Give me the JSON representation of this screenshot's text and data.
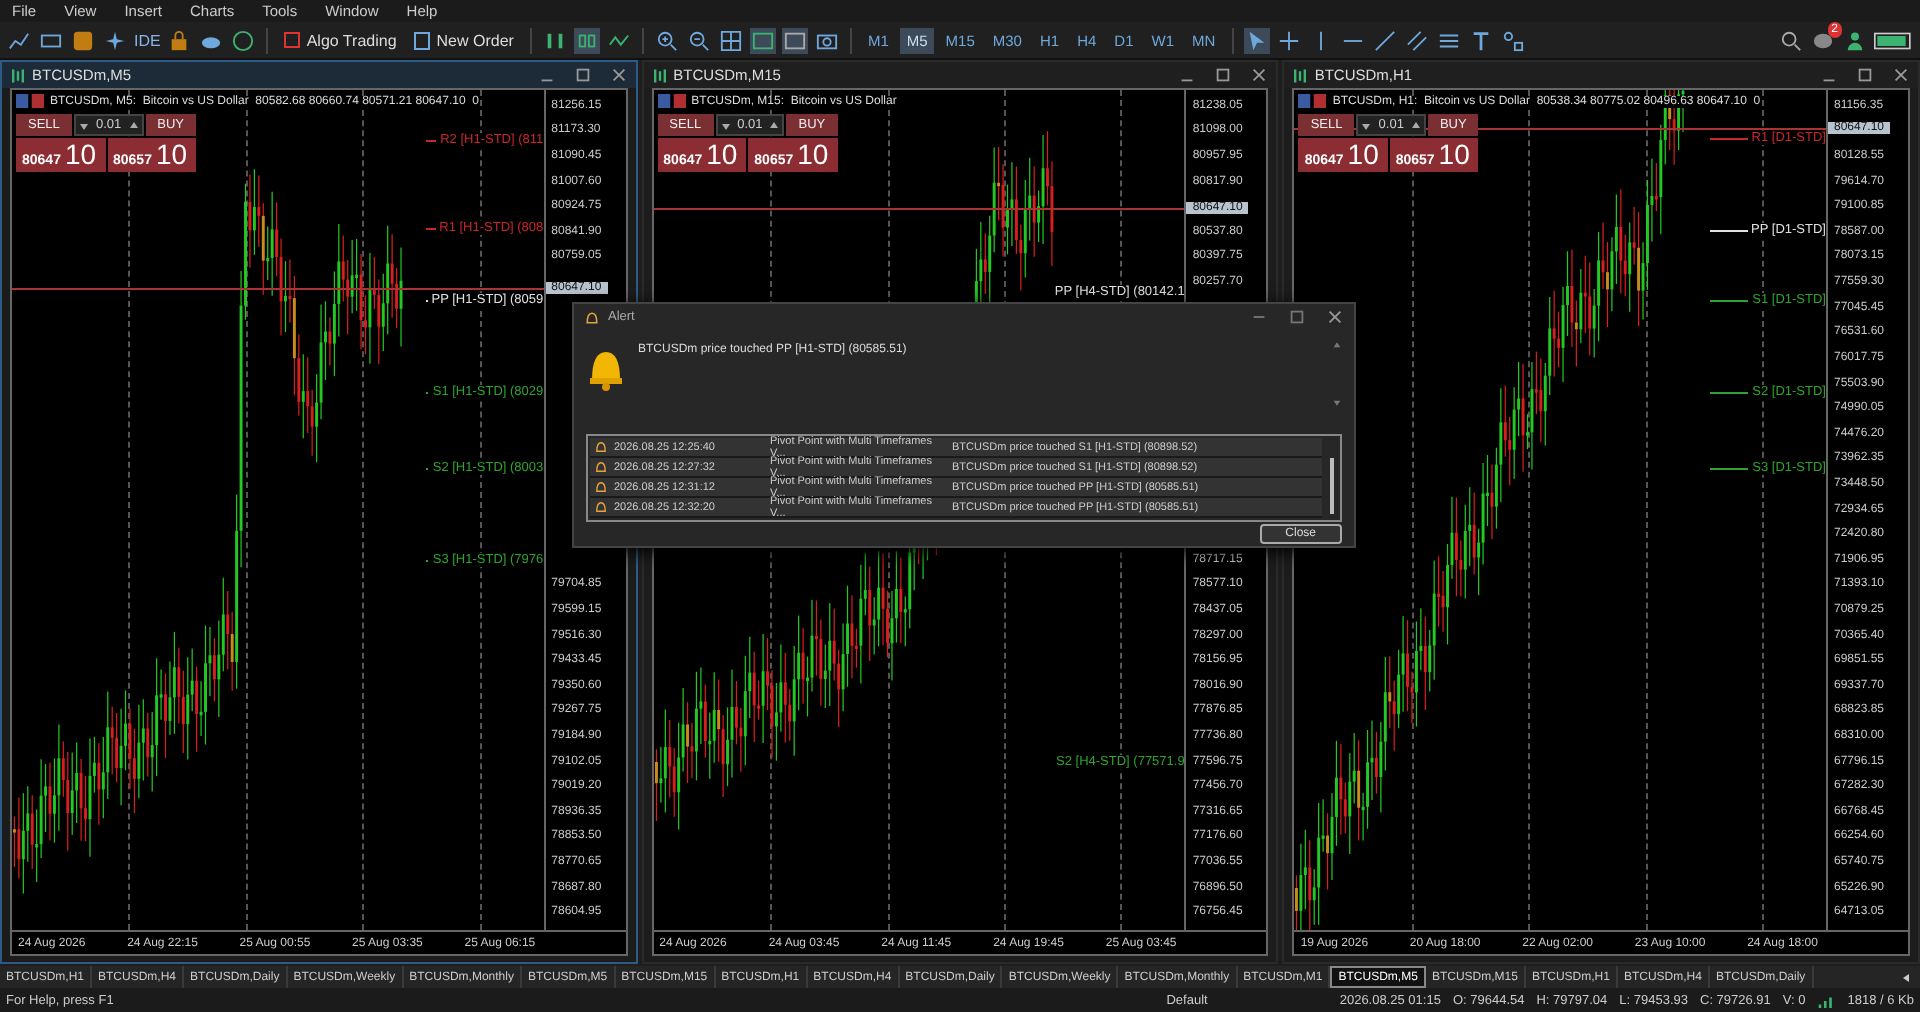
{
  "menu": [
    "File",
    "View",
    "Insert",
    "Charts",
    "Tools",
    "Window",
    "Help"
  ],
  "toolbar": {
    "ide": "IDE",
    "algo_trading": "Algo Trading",
    "new_order": "New Order",
    "notification_badge": "2",
    "timeframes": [
      {
        "label": "M1",
        "selected": false
      },
      {
        "label": "M5",
        "selected": true
      },
      {
        "label": "M15",
        "selected": false
      },
      {
        "label": "M30",
        "selected": false
      },
      {
        "label": "H1",
        "selected": false
      },
      {
        "label": "H4",
        "selected": false
      },
      {
        "label": "D1",
        "selected": false
      },
      {
        "label": "W1",
        "selected": false
      },
      {
        "label": "MN",
        "selected": false
      }
    ]
  },
  "charts": [
    {
      "title": "BTCUSDm,M5",
      "active": true,
      "info": "BTCUSDm, M5:  Bitcoin vs US Dollar  80582.68 80660.74 80571.21 80647.10  0",
      "trade": {
        "sell": "SELL",
        "buy": "BUY",
        "volume": "0.01",
        "bid_small": "80647",
        "bid_big": "10",
        "ask_small": "80657",
        "ask_big": "10"
      },
      "current_price": "80647.10",
      "price_groups": [
        [
          "81256.15",
          "81173.30",
          "81090.45",
          "81007.60",
          "80924.75",
          "80841.90",
          "80759.05"
        ],
        [
          "79704.85",
          "79599.15",
          "79516.30",
          "79433.45",
          "79350.60",
          "79267.75",
          "79184.90",
          "79102.05",
          "79019.20",
          "78936.35",
          "78853.50",
          "78770.65",
          "78687.80",
          "78604.95"
        ]
      ],
      "pivots": [
        {
          "label": "R2 [H1-STD] (811",
          "kind": "resistance"
        },
        {
          "label": "R1 [H1-STD] (808",
          "kind": "resistance"
        },
        {
          "label": "PP [H1-STD] (8059",
          "kind": "pivot"
        },
        {
          "label": "S1 [H1-STD] (8029",
          "kind": "support"
        },
        {
          "label": "S2 [H1-STD] (8003",
          "kind": "support"
        },
        {
          "label": "S3 [H1-STD] (7976",
          "kind": "support"
        }
      ],
      "times": [
        "24 Aug 2026",
        "24 Aug 22:15",
        "25 Aug 00:55",
        "25 Aug 03:35",
        "25 Aug 06:15"
      ]
    },
    {
      "title": "BTCUSDm,M15",
      "active": false,
      "info": "BTCUSDm, M15:  Bitcoin vs US Dollar",
      "trade": {
        "sell": "SELL",
        "buy": "BUY",
        "volume": "0.01",
        "bid_small": "80647",
        "bid_big": "10",
        "ask_small": "80657",
        "ask_big": "10"
      },
      "current_price": "80647.10",
      "price_groups": [
        [
          "81238.05",
          "81098.00",
          "80957.95",
          "80817.90"
        ],
        [
          "80537.80",
          "80397.75",
          "80257.70"
        ],
        [
          "78717.15",
          "78577.10",
          "78437.05",
          "78297.00",
          "78156.95",
          "78016.90",
          "77876.85",
          "77736.80",
          "77596.75",
          "77456.70",
          "77316.65",
          "77176.60",
          "77036.55",
          "76896.50",
          "76756.45"
        ]
      ],
      "pivots": [
        {
          "label": "PP [H4-STD] (80142.1",
          "kind": "pivot"
        },
        {
          "label": "S2 [H4-STD] (77571.9",
          "kind": "support"
        }
      ],
      "times": [
        "24 Aug 2026",
        "24 Aug 03:45",
        "24 Aug 11:45",
        "24 Aug 19:45",
        "25 Aug 03:45"
      ]
    },
    {
      "title": "BTCUSDm,H1",
      "active": false,
      "info": "BTCUSDm, H1:  Bitcoin vs US Dollar  80538.34 80775.02 80496.63 80647.10  0",
      "trade": {
        "sell": "SELL",
        "buy": "BUY",
        "volume": "0.01",
        "bid_small": "80647",
        "bid_big": "10",
        "ask_small": "80657",
        "ask_big": "10"
      },
      "current_price": "80647.10",
      "price_groups": [
        [
          "81156.35"
        ],
        [
          "80128.55",
          "79614.70",
          "79100.85",
          "78587.00",
          "78073.15",
          "77559.30",
          "77045.45",
          "76531.60",
          "76017.75",
          "75503.90",
          "74990.05",
          "74476.20",
          "73962.35",
          "73448.50",
          "72934.65",
          "72420.80",
          "71906.95",
          "71393.10",
          "70879.25",
          "70365.40",
          "69851.55",
          "69337.70",
          "68823.85",
          "68310.00",
          "67796.15",
          "67282.30",
          "66768.45",
          "66254.60",
          "65740.75",
          "65226.90",
          "64713.05"
        ]
      ],
      "pivots": [
        {
          "label": "R1 [D1-STD]",
          "kind": "resistance"
        },
        {
          "label": "PP [D1-STD]",
          "kind": "pivot"
        },
        {
          "label": "S1 [D1-STD]",
          "kind": "support"
        },
        {
          "label": "S2 [D1-STD]",
          "kind": "support"
        },
        {
          "label": "S3 [D1-STD]",
          "kind": "support"
        }
      ],
      "times": [
        "19 Aug 2026",
        "20 Aug 18:00",
        "22 Aug 02:00",
        "23 Aug 10:00",
        "24 Aug 18:00"
      ]
    }
  ],
  "alert": {
    "title": "Alert",
    "message": "BTCUSDm price touched PP [H1-STD] (80585.51)",
    "rows": [
      {
        "time": "2026.08.25 12:25:40",
        "source": "Pivot Point with Multi Timeframes V...",
        "message": "BTCUSDm price touched S1 [H1-STD] (80898.52)"
      },
      {
        "time": "2026.08.25 12:27:32",
        "source": "Pivot Point with Multi Timeframes V...",
        "message": "BTCUSDm price touched S1 [H1-STD] (80898.52)"
      },
      {
        "time": "2026.08.25 12:31:12",
        "source": "Pivot Point with Multi Timeframes V...",
        "message": "BTCUSDm price touched PP [H1-STD] (80585.51)"
      },
      {
        "time": "2026.08.25 12:32:20",
        "source": "Pivot Point with Multi Timeframes V...",
        "message": "BTCUSDm price touched PP [H1-STD] (80585.51)"
      }
    ],
    "close": "Close"
  },
  "tabs": [
    {
      "label": "BTCUSDm,H1",
      "selected": false
    },
    {
      "label": "BTCUSDm,H4",
      "selected": false
    },
    {
      "label": "BTCUSDm,Daily",
      "selected": false
    },
    {
      "label": "BTCUSDm,Weekly",
      "selected": false
    },
    {
      "label": "BTCUSDm,Monthly",
      "selected": false
    },
    {
      "label": "BTCUSDm,M5",
      "selected": false
    },
    {
      "label": "BTCUSDm,M15",
      "selected": false
    },
    {
      "label": "BTCUSDm,H1",
      "selected": false
    },
    {
      "label": "BTCUSDm,H4",
      "selected": false
    },
    {
      "label": "BTCUSDm,Daily",
      "selected": false
    },
    {
      "label": "BTCUSDm,Weekly",
      "selected": false
    },
    {
      "label": "BTCUSDm,Monthly",
      "selected": false
    },
    {
      "label": "BTCUSDm,M1",
      "selected": false
    },
    {
      "label": "BTCUSDm,M5",
      "selected": true
    },
    {
      "label": "BTCUSDm,M15",
      "selected": false
    },
    {
      "label": "BTCUSDm,H1",
      "selected": false
    },
    {
      "label": "BTCUSDm,H4",
      "selected": false
    },
    {
      "label": "BTCUSDm,Daily",
      "selected": false
    }
  ],
  "status_bar": {
    "help": "For Help, press F1",
    "profile": "Default",
    "time": "2026.08.25 01:15",
    "open": "O: 79644.54",
    "high": "H: 79797.04",
    "low": "L: 79453.93",
    "close": "C: 79726.91",
    "volume": "V: 0",
    "traffic": "1818 / 6 Kb"
  }
}
